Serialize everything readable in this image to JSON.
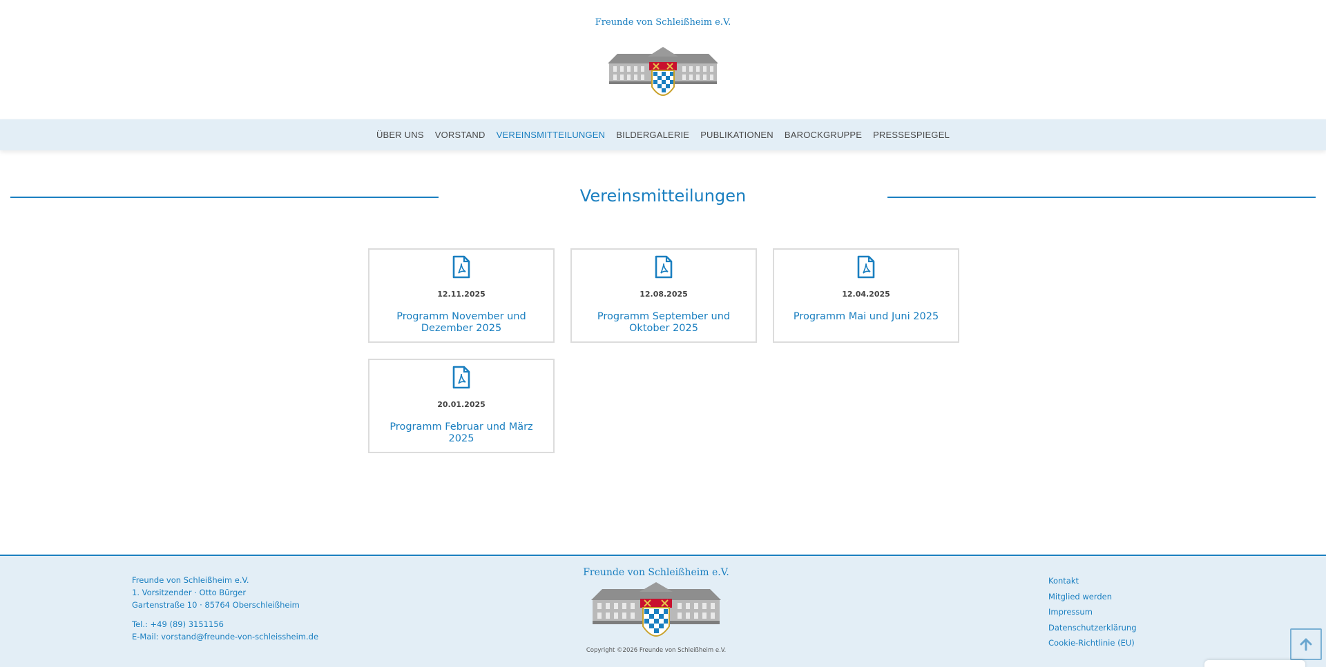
{
  "header": {
    "brand_title": "Freunde von Schleißheim e.V.",
    "logo_icon": "schloss-wappen-logo"
  },
  "nav": {
    "items": [
      {
        "label": "ÜBER UNS",
        "active": false
      },
      {
        "label": "VORSTAND",
        "active": false
      },
      {
        "label": "VEREINSMITTEILUNGEN",
        "active": true
      },
      {
        "label": "BILDERGALERIE",
        "active": false
      },
      {
        "label": "PUBLIKATIONEN",
        "active": false
      },
      {
        "label": "BAROCKGRUPPE",
        "active": false
      },
      {
        "label": "PRESSESPIEGEL",
        "active": false
      }
    ]
  },
  "main": {
    "title": "Vereinsmitteilungen",
    "documents": [
      {
        "date": "12.11.2025",
        "title": "Programm November und Dezember 2025",
        "icon": "pdf-file-icon"
      },
      {
        "date": "12.08.2025",
        "title": "Programm September und Oktober 2025",
        "icon": "pdf-file-icon"
      },
      {
        "date": "12.04.2025",
        "title": "Programm Mai und Juni 2025",
        "icon": "pdf-file-icon"
      },
      {
        "date": "20.01.2025",
        "title": "Programm Februar und März 2025",
        "icon": "pdf-file-icon"
      }
    ]
  },
  "footer": {
    "address": {
      "line1": "Freunde von Schleißheim e.V.",
      "line2": "1. Vorsitzender · Otto Bürger",
      "line3": "Gartenstraße 10 · 85764 Oberschleißheim",
      "phone": "Tel.: +49 (89) 3151156",
      "email": "E-Mail: vorstand@freunde-von-schleissheim.de"
    },
    "center_title": "Freunde von Schleißheim e.V.",
    "copyright": "Copyright ©2026 Freunde von Schleißheim e.V.",
    "links": [
      "Kontakt",
      "Mitglied werden",
      "Impressum",
      "Datenschutzerklärung",
      "Cookie-Richtlinie (EU)"
    ],
    "to_top_icon": "arrow-up-icon"
  },
  "colors": {
    "accent": "#1a7fc0",
    "nav_bg": "#e3eef6",
    "text": "#4a4a4a"
  }
}
